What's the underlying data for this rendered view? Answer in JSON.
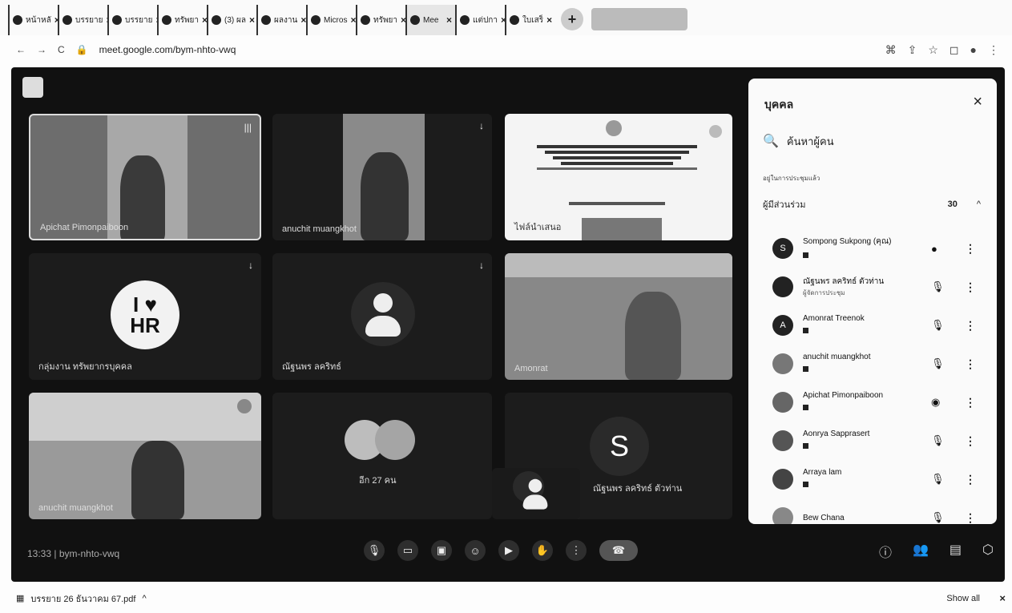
{
  "browser": {
    "tabs": [
      {
        "label": "หน้าหลั"
      },
      {
        "label": "บรรยาย"
      },
      {
        "label": "บรรยาย"
      },
      {
        "label": "ทรัพยา"
      },
      {
        "label": "(3) ผล"
      },
      {
        "label": "ผลงาน"
      },
      {
        "label": "Micros"
      },
      {
        "label": "ทรัพยา"
      },
      {
        "label": "Mee"
      },
      {
        "label": "แต่ปกา"
      },
      {
        "label": "ใบเสร็"
      }
    ],
    "url": "meet.google.com/bym-nhto-vwq"
  },
  "tiles": [
    {
      "name": "Apichat Pimonpaiboon",
      "mic": "|||"
    },
    {
      "name": "anuchit muangkhot",
      "mic": "↓"
    },
    {
      "name": "ไฟล์นำเสนอ"
    },
    {
      "name": "กลุ่มงาน ทรัพยากรบุคคล",
      "mic": "↓",
      "badge_top": "I ♥",
      "badge_bottom": "HR"
    },
    {
      "name": "ณัฐนพร ลคริทธ์",
      "mic": "↓"
    },
    {
      "name": "Amonrat"
    },
    {
      "name": "anuchit muangkhot"
    },
    {
      "name": "อีก 27 คน"
    },
    {
      "name": "ณัฐนพร ลคริทธ์ ตัวท่าน",
      "avatar_letter": "S"
    }
  ],
  "meeting": {
    "time": "13:33",
    "code": "bym-nhto-vwq"
  },
  "panel": {
    "title": "บุคคล",
    "search_placeholder": "ค้นหาผู้คน",
    "subhead": "อยู่ในการประชุมแล้ว",
    "group_label": "ผู้มีส่วนร่วม",
    "count": "30",
    "participants": [
      {
        "name": "Sompong Sukpong (คุณ)",
        "sub": "",
        "avatar": "S"
      },
      {
        "name": "ณัฐนพร ลคริทธ์ ตัวท่าน",
        "sub": "ผู้จัดการประชุม",
        "avatar": ""
      },
      {
        "name": "Amonrat Treenok",
        "sub": "",
        "avatar": "A"
      },
      {
        "name": "anuchit muangkhot",
        "sub": "",
        "avatar": ""
      },
      {
        "name": "Apichat Pimonpaiboon",
        "sub": "",
        "avatar": ""
      },
      {
        "name": "Aonrya Sapprasert",
        "sub": "",
        "avatar": ""
      },
      {
        "name": "Arraya lam",
        "sub": "",
        "avatar": ""
      },
      {
        "name": "Bew Chana",
        "sub": "",
        "avatar": ""
      }
    ]
  },
  "download": {
    "file": "บรรยาย 26 ธันวาคม 67.pdf",
    "show_all": "Show all"
  }
}
